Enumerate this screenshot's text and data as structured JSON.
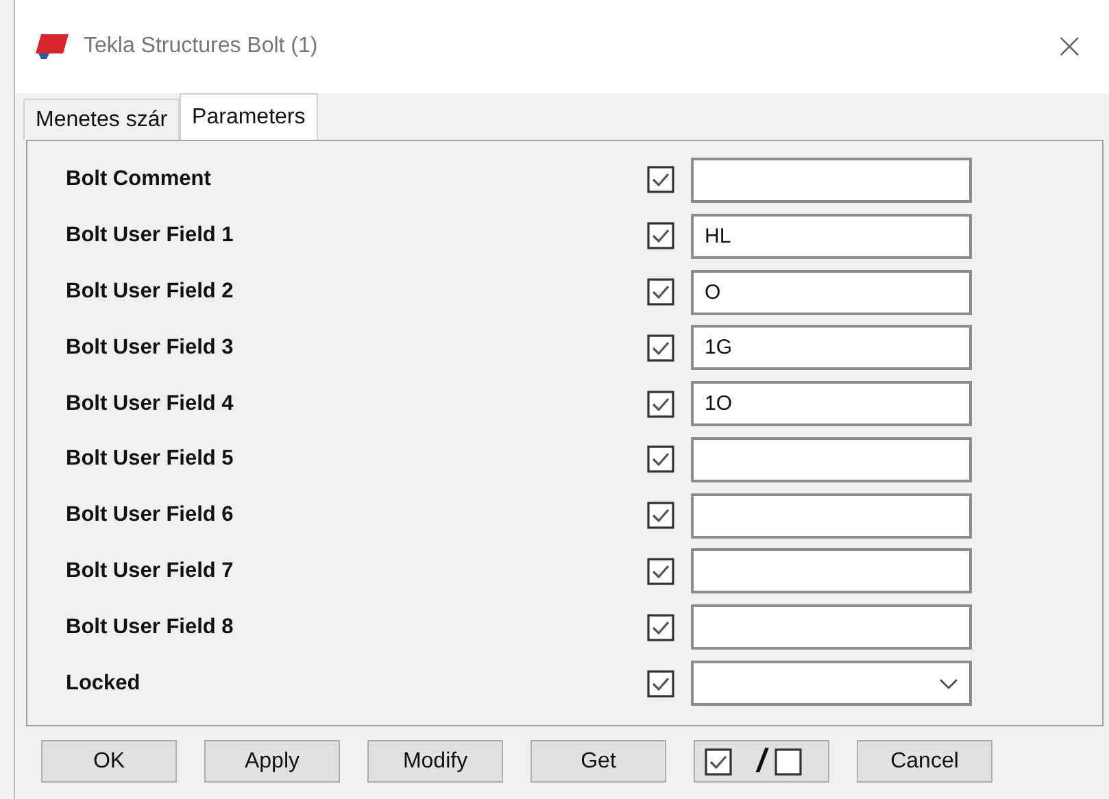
{
  "window": {
    "title": "Tekla Structures  Bolt (1)",
    "close": "×"
  },
  "tabs": [
    {
      "label": "Menetes szár",
      "selected": false
    },
    {
      "label": "Parameters",
      "selected": true
    }
  ],
  "fields": [
    {
      "label": "Bolt Comment",
      "checked": true,
      "kind": "text"
    },
    {
      "label": "Bolt User Field 1",
      "checked": true,
      "kind": "text",
      "value": "HL"
    },
    {
      "label": "Bolt User Field 2",
      "checked": true,
      "kind": "text",
      "value": "O"
    },
    {
      "label": "Bolt User Field 3",
      "checked": true,
      "kind": "text",
      "value": "1G"
    },
    {
      "label": "Bolt User Field 4",
      "checked": true,
      "kind": "text",
      "value": "1O"
    },
    {
      "label": "Bolt User Field 5",
      "checked": true,
      "kind": "text"
    },
    {
      "label": "Bolt User Field 6",
      "checked": true,
      "kind": "text"
    },
    {
      "label": "Bolt User Field 7",
      "checked": true,
      "kind": "text"
    },
    {
      "label": "Bolt User Field 8",
      "checked": true,
      "kind": "text"
    },
    {
      "label": "Locked",
      "checked": true,
      "kind": "dropdown"
    }
  ],
  "buttons": [
    {
      "label": "OK",
      "kind": "text"
    },
    {
      "label": "Apply",
      "kind": "text"
    },
    {
      "label": "Modify",
      "kind": "text"
    },
    {
      "label": "Get",
      "kind": "text"
    },
    {
      "label": "/",
      "kind": "toggle-all"
    },
    {
      "label": "Cancel",
      "kind": "text"
    }
  ]
}
